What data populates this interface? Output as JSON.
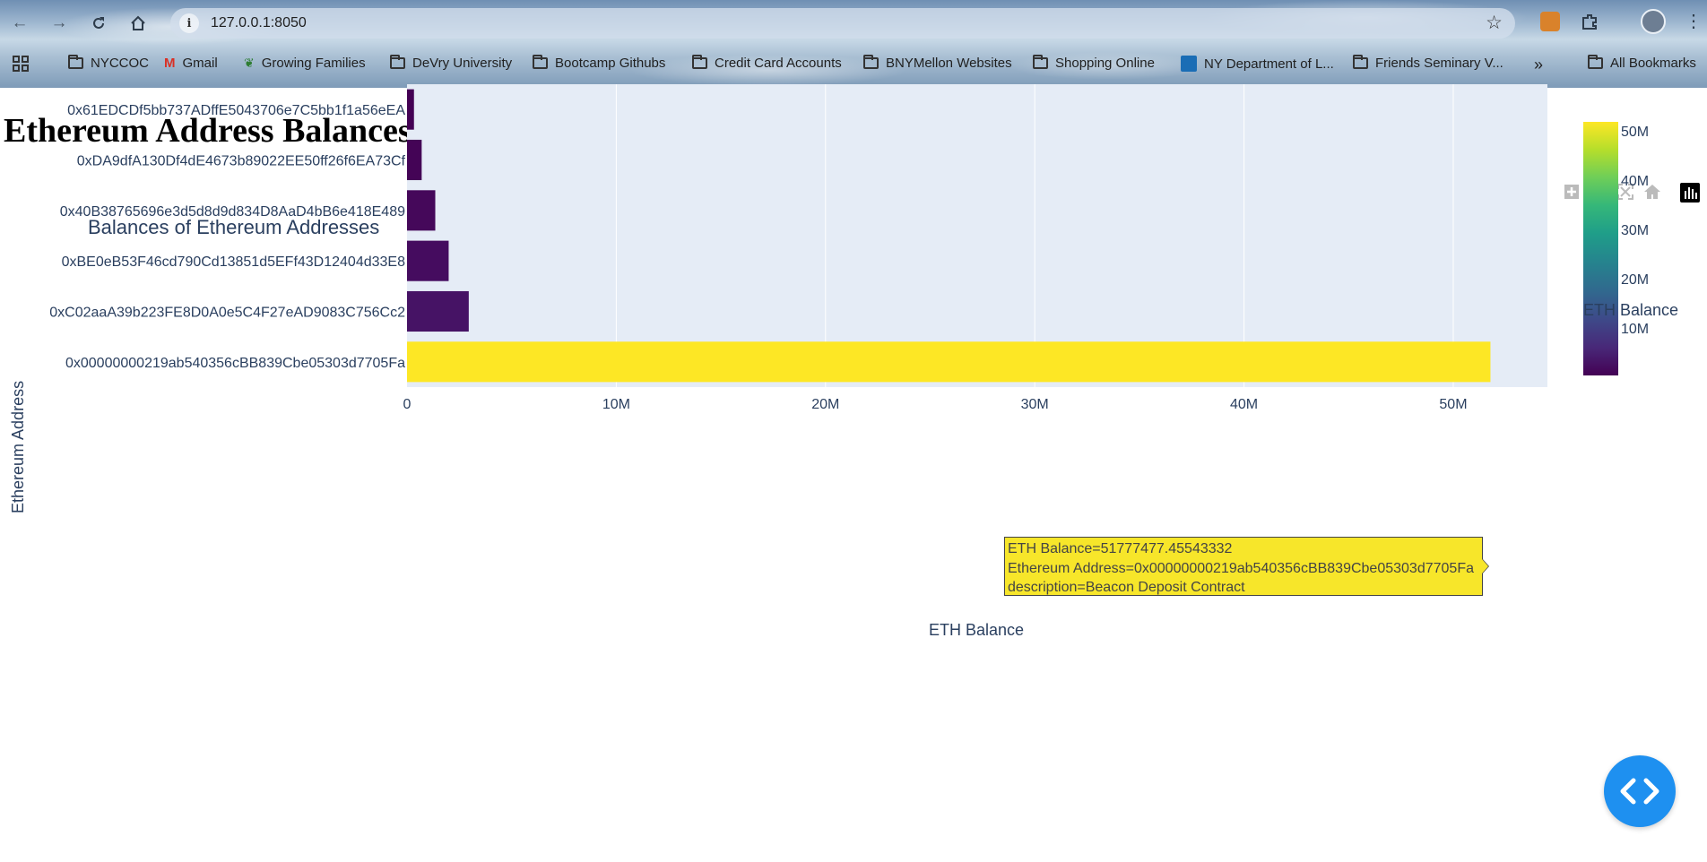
{
  "browser": {
    "url": "127.0.0.1:8050",
    "bookmarks": [
      {
        "label": "NYCCOC",
        "icon": "folder-icon"
      },
      {
        "label": "Gmail",
        "icon": "gmail-icon"
      },
      {
        "label": "Growing Families",
        "icon": "leaf-icon"
      },
      {
        "label": "DeVry University",
        "icon": "folder-icon"
      },
      {
        "label": "Bootcamp Githubs",
        "icon": "folder-icon"
      },
      {
        "label": "Credit Card Accounts",
        "icon": "folder-icon"
      },
      {
        "label": "BNYMellon Websites",
        "icon": "folder-icon"
      },
      {
        "label": "Shopping Online",
        "icon": "folder-icon"
      },
      {
        "label": "NY Department of L...",
        "icon": "ny-state-icon"
      },
      {
        "label": "Friends Seminary V...",
        "icon": "folder-icon"
      },
      {
        "label": "All Bookmarks",
        "icon": "folder-icon"
      }
    ],
    "overflow_label": "»"
  },
  "page": {
    "title": "Ethereum Address Balances"
  },
  "chart_data": {
    "type": "bar",
    "orientation": "horizontal",
    "title": "Balances of Ethereum Addresses",
    "xlabel": "ETH Balance",
    "ylabel": "Ethereum Address",
    "xlim": [
      0,
      54500000
    ],
    "x_ticks": [
      0,
      10000000,
      20000000,
      30000000,
      40000000,
      50000000
    ],
    "x_tick_labels": [
      "0",
      "10M",
      "20M",
      "30M",
      "40M",
      "50M"
    ],
    "categories": [
      "0x61EDCDf5bb737ADffE5043706e7C5bb1f1a56eEA",
      "0xDA9dfA130Df4dE4673b89022EE50ff26f6EA73Cf",
      "0x40B38765696e3d5d8d9d834D8AaD4bB6e418E489",
      "0xBE0eB53F46cd790Cd13851d5EFf43D12404d33E8",
      "0xC02aaA39b223FE8D0A0e5C4F27eAD9083C756Cc2",
      "0x00000000219ab540356cBB839Cbe05303d7705Fa"
    ],
    "values": [
      332000,
      700000,
      1350000,
      1990000,
      2950000,
      51777477.45543332
    ],
    "colorbar": {
      "title": "ETH Balance",
      "ticks": [
        10000000,
        20000000,
        30000000,
        40000000,
        50000000
      ],
      "tick_labels": [
        "10M",
        "20M",
        "30M",
        "40M",
        "50M"
      ],
      "range": [
        332000,
        51777477.45543332
      ],
      "colorscale": "Viridis"
    },
    "grid": true
  },
  "tooltip": {
    "line1": "ETH Balance=51777477.45543332",
    "line2": "Ethereum Address=0x00000000219ab540356cBB839Cbe05303d7705Fa",
    "line3": "description=Beacon Deposit Contract"
  },
  "colors": {
    "plot_bg": "#e5ecf6",
    "axis_text": "#2a3f5f",
    "code_button": "#1e90f0"
  }
}
